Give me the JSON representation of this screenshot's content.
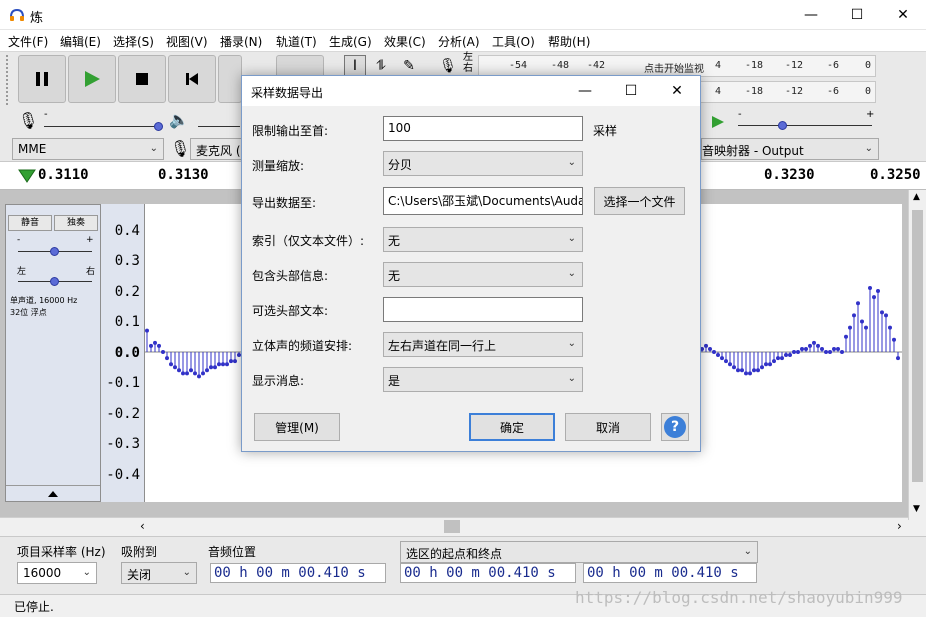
{
  "window": {
    "title": "炼",
    "min_glyph": "—",
    "max_glyph": "☐",
    "close_glyph": "✕"
  },
  "menu": [
    "文件(F)",
    "编辑(E)",
    "选择(S)",
    "视图(V)",
    "播录(N)",
    "轨道(T)",
    "生成(G)",
    "效果(C)",
    "分析(A)",
    "工具(O)",
    "帮助(H)"
  ],
  "meters": {
    "record_label": "左右",
    "record_scale": [
      "-54",
      "-48",
      "-42"
    ],
    "record_hint": "点击开始监视",
    "record_scale_right": [
      "4",
      "-18",
      "-12",
      "-6",
      "0"
    ],
    "play_scale": [
      "4",
      "-18",
      "-12",
      "-6",
      "0"
    ]
  },
  "devices": {
    "host": "MME",
    "input": "麦克风 (",
    "output": "音映射器 - Output"
  },
  "timeline": {
    "labels_left": [
      "0.3110",
      "0.3130"
    ],
    "labels_right": [
      "0.3230",
      "0.3250"
    ]
  },
  "track": {
    "mute": "静音",
    "solo": "独奏",
    "gain_left": "-",
    "gain_right": "+",
    "pan_left": "左",
    "pan_right": "右",
    "info1": "单声道, 16000 Hz",
    "info2": "32位 浮点",
    "ruler": [
      "0.4",
      "0.3",
      "0.2",
      "0.1",
      "0.0",
      "-0.1",
      "-0.2",
      "-0.3",
      "-0.4"
    ],
    "samples": [
      0.07,
      0.02,
      0.03,
      0.02,
      0.0,
      -0.02,
      -0.04,
      -0.05,
      -0.06,
      -0.07,
      -0.07,
      -0.06,
      -0.07,
      -0.08,
      -0.07,
      -0.06,
      -0.05,
      -0.05,
      -0.04,
      -0.04,
      -0.04,
      -0.03,
      -0.03,
      -0.01,
      0.01,
      0.02,
      0.01,
      0.0,
      -0.01,
      -0.02,
      -0.03,
      -0.04,
      -0.05,
      -0.06,
      -0.06,
      -0.07,
      -0.07,
      -0.06,
      -0.06,
      -0.05,
      -0.04,
      -0.04,
      -0.03,
      -0.02,
      -0.02,
      -0.01,
      -0.01,
      0.0,
      0.0,
      0.01,
      0.01,
      0.02,
      0.03,
      0.02,
      0.01,
      0.0,
      0.0,
      0.01,
      0.01,
      0.0,
      0.05,
      0.08,
      0.12,
      0.16,
      0.1,
      0.08,
      0.21,
      0.18,
      0.2,
      0.13,
      0.12,
      0.08,
      0.04,
      -0.02
    ]
  },
  "selection_bar": {
    "rate_label": "项目采样率 (Hz)",
    "rate_value": "16000",
    "snap_label": "吸附到",
    "snap_value": "关闭",
    "pos_label": "音频位置",
    "sel_mode": "选区的起点和终点",
    "time1": "00 h 00 m 00.410 s",
    "time2": "00 h 00 m 00.410 s",
    "time3": "00 h 00 m 00.410 s"
  },
  "status": {
    "text": "已停止."
  },
  "watermark": "https://blog.csdn.net/shaoyubin999",
  "dialog": {
    "title": "采样数据导出",
    "limit_label": "限制输出至首:",
    "limit_value": "100",
    "limit_unit": "采样",
    "scale_label": "测量缩放:",
    "scale_value": "分贝",
    "export_label": "导出数据至:",
    "export_path": "C:\\Users\\邵玉斌\\Documents\\Audacity",
    "choose_file": "选择一个文件",
    "index_label": "索引（仅文本文件）:",
    "index_value": "无",
    "header_label": "包含头部信息:",
    "header_value": "无",
    "optional_header_label": "可选头部文本:",
    "optional_header_value": "",
    "stereo_label": "立体声的频道安排:",
    "stereo_value": "左右声道在同一行上",
    "show_msg_label": "显示消息:",
    "show_msg_value": "是",
    "manage_btn": "管理(M)",
    "ok_btn": "确定",
    "cancel_btn": "取消",
    "help_glyph": "?"
  },
  "colors": {
    "accent": "#3c5fd0",
    "wave": "#3232c8",
    "play_green": "#33a033"
  }
}
